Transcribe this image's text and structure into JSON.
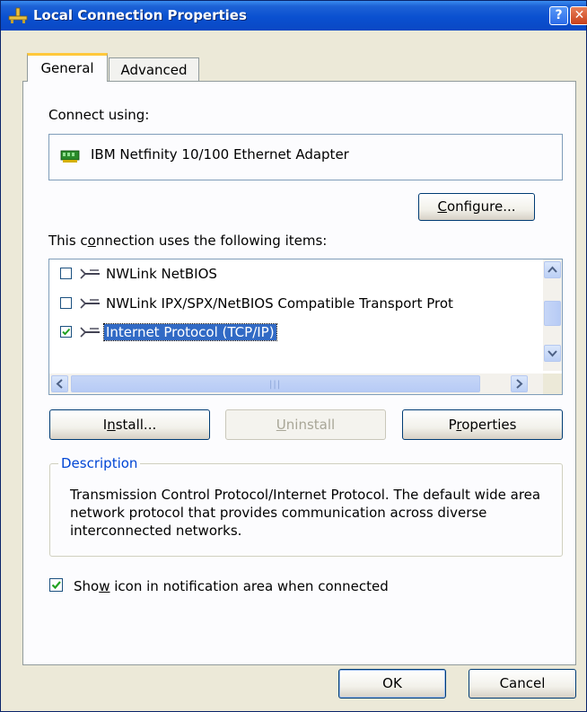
{
  "window": {
    "title": "Local Connection Properties",
    "help_glyph": "?",
    "close_glyph": "✕"
  },
  "tabs": [
    {
      "label": "General",
      "active": true
    },
    {
      "label": "Advanced",
      "active": false
    }
  ],
  "general": {
    "connect_using_label": "Connect using:",
    "adapter_name": "IBM Netfinity 10/100 Ethernet Adapter",
    "configure_button": {
      "pre": "",
      "key": "C",
      "post": "onfigure..."
    },
    "items_label": {
      "pre": "This c",
      "key": "o",
      "post": "nnection uses the following items:"
    },
    "items": [
      {
        "label": "NWLink NetBIOS",
        "checked": false,
        "selected": false
      },
      {
        "label": "NWLink IPX/SPX/NetBIOS Compatible Transport Prot",
        "checked": false,
        "selected": false
      },
      {
        "label": "Internet Protocol (TCP/IP)",
        "checked": true,
        "selected": true
      }
    ],
    "buttons": {
      "install": {
        "pre": "I",
        "key": "n",
        "post": "stall..."
      },
      "uninstall": {
        "pre": "",
        "key": "U",
        "post": "ninstall"
      },
      "properties": {
        "pre": "P",
        "key": "r",
        "post": "operties"
      }
    },
    "description": {
      "title": "Description",
      "text": "Transmission Control Protocol/Internet Protocol. The default wide area network protocol that provides communication across diverse interconnected networks."
    },
    "show_icon": {
      "pre": "Sho",
      "key": "w",
      "post": " icon in notification area when connected",
      "checked": true
    }
  },
  "footer": {
    "ok_label": "OK",
    "cancel_label": "Cancel"
  },
  "colors": {
    "titlebar": "#0a50d0",
    "selection": "#316ac5",
    "group_title": "#0046d5",
    "dialog_bg": "#ece9d8"
  }
}
